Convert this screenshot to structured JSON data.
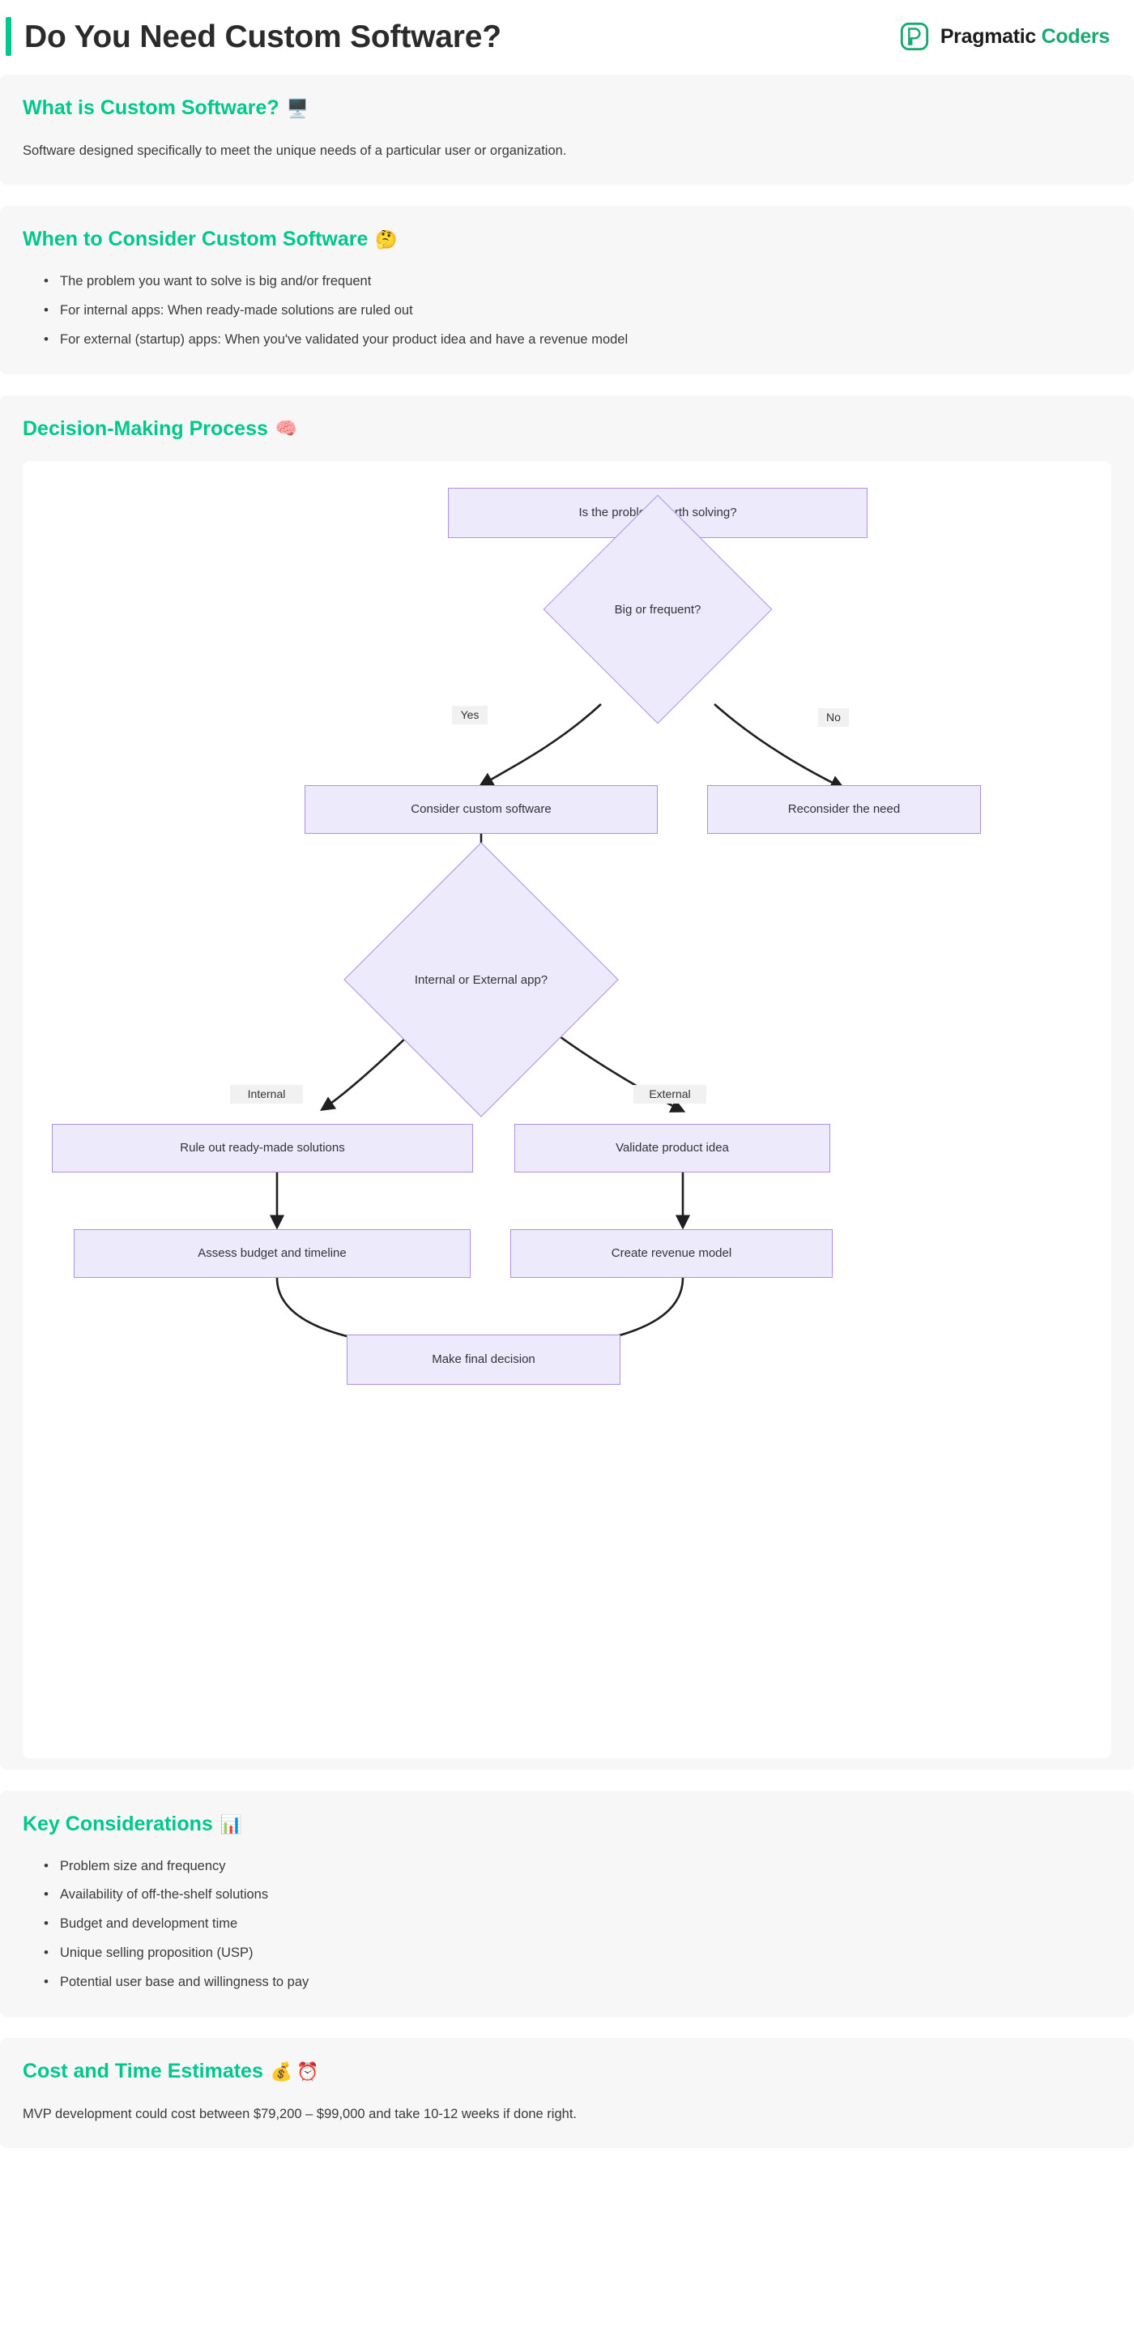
{
  "header": {
    "title": "Do You Need Custom Software?",
    "brand": {
      "icon": "pragmatic-coders-logo-icon",
      "part1": "Pragmatic",
      "part2": "Coders"
    },
    "accent_color": "#00c88c"
  },
  "sections": {
    "what_is": {
      "heading": "What is Custom Software?",
      "emoji": "🖥️",
      "body": "Software designed specifically to meet the unique needs of a particular user or organization."
    },
    "when_to_consider": {
      "heading": "When to Consider Custom Software",
      "emoji": "🤔",
      "items": [
        "The problem you want to solve is big and/or frequent",
        "For internal apps: When ready-made solutions are ruled out",
        "For external (startup) apps: When you've validated your product idea and have a revenue model"
      ]
    },
    "decision_process": {
      "heading": "Decision-Making Process",
      "emoji": "🧠"
    },
    "key_considerations": {
      "heading": "Key Considerations",
      "emoji": "📊",
      "items": [
        "Problem size and frequency",
        "Availability of off-the-shelf solutions",
        "Budget and development time",
        "Unique selling proposition (USP)",
        "Potential user base and willingness to pay"
      ]
    },
    "cost_time": {
      "heading": "Cost and Time Estimates",
      "emoji1": "💰",
      "emoji2": "⏰",
      "body": "MVP development could cost between $79,200 – $99,000 and take 10-12 weeks if done right."
    }
  },
  "flowchart": {
    "node_fill": "#eceafb",
    "node_border": "#ae8fe6",
    "nodes": {
      "n1": "Is the problem worth solving?",
      "n2": "Big or frequent?",
      "n3": "Consider custom software",
      "n4": "Reconsider the need",
      "n5": "Internal or External app?",
      "n6": "Rule out ready-made solutions",
      "n7": "Validate product idea",
      "n8": "Assess budget and timeline",
      "n9": "Create revenue model",
      "n10": "Make final decision"
    },
    "edge_labels": {
      "yes": "Yes",
      "no": "No",
      "internal": "Internal",
      "external": "External"
    }
  }
}
